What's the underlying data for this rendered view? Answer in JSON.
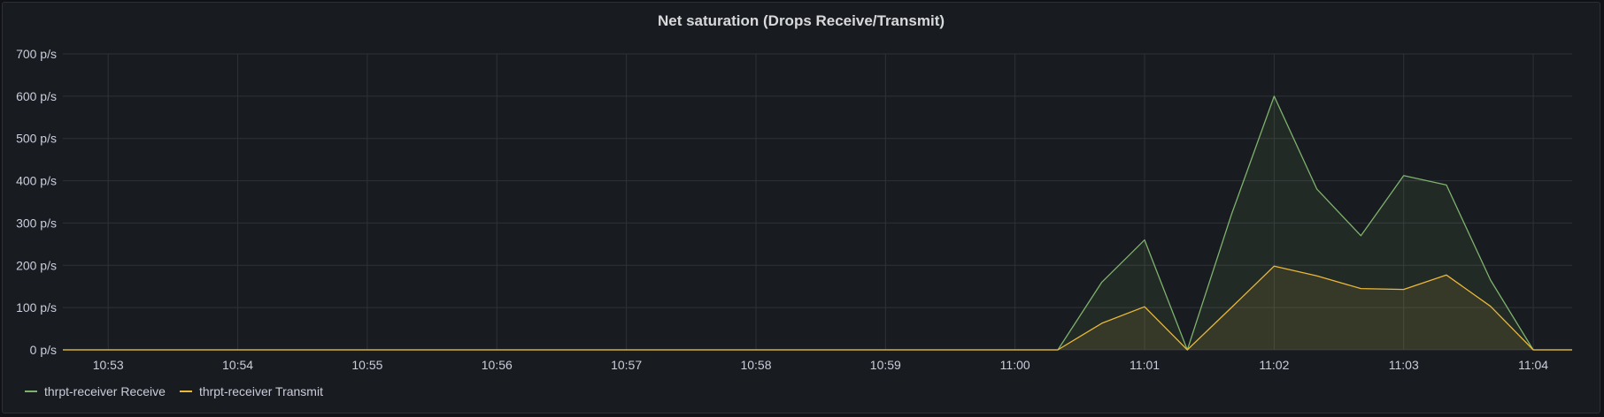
{
  "panel": {
    "title": "Net saturation (Drops Receive/Transmit)"
  },
  "colors": {
    "receive": "#7eb26d",
    "transmit": "#eab839",
    "grid": "#2f3238",
    "text": "#ccccdc"
  },
  "chart_data": {
    "type": "area",
    "title": "Net saturation (Drops Receive/Transmit)",
    "xlabel": "",
    "ylabel": "",
    "x_ticks": [
      "10:53",
      "10:54",
      "10:55",
      "10:56",
      "10:57",
      "10:58",
      "10:59",
      "11:00",
      "11:01",
      "11:02",
      "11:03",
      "11:04"
    ],
    "y_ticks": [
      "0 p/s",
      "100 p/s",
      "200 p/s",
      "300 p/s",
      "400 p/s",
      "500 p/s",
      "600 p/s",
      "700 p/s"
    ],
    "ylim": [
      0,
      700
    ],
    "x_unit": "minutes after 10:52",
    "xlim": [
      0.65,
      12.3
    ],
    "grid": true,
    "legend_position": "bottom-left",
    "series": [
      {
        "name": "thrpt-receiver Receive",
        "color": "#7eb26d",
        "points": [
          [
            0.65,
            0
          ],
          [
            8.33,
            0
          ],
          [
            8.67,
            160
          ],
          [
            9.0,
            260
          ],
          [
            9.33,
            0
          ],
          [
            9.67,
            320
          ],
          [
            10.0,
            600
          ],
          [
            10.33,
            380
          ],
          [
            10.67,
            270
          ],
          [
            11.0,
            412
          ],
          [
            11.33,
            390
          ],
          [
            11.67,
            165
          ],
          [
            12.0,
            0
          ],
          [
            12.3,
            0
          ]
        ]
      },
      {
        "name": "thrpt-receiver Transmit",
        "color": "#eab839",
        "points": [
          [
            0.65,
            0
          ],
          [
            8.33,
            0
          ],
          [
            8.67,
            63
          ],
          [
            9.0,
            102
          ],
          [
            9.33,
            0
          ],
          [
            9.67,
            100
          ],
          [
            10.0,
            198
          ],
          [
            10.33,
            175
          ],
          [
            10.67,
            145
          ],
          [
            11.0,
            143
          ],
          [
            11.33,
            177
          ],
          [
            11.67,
            103
          ],
          [
            12.0,
            0
          ],
          [
            12.3,
            0
          ]
        ]
      }
    ]
  }
}
